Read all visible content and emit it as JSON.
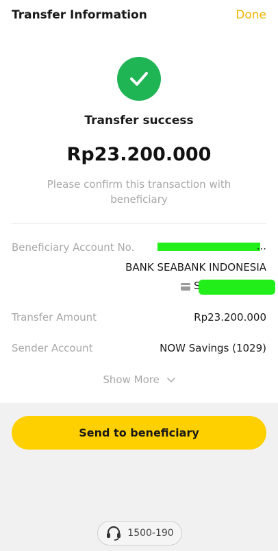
{
  "header": {
    "title": "Transfer Information",
    "done_label": "Done"
  },
  "status": {
    "icon": "check-icon",
    "text": "Transfer success",
    "amount": "Rp23.200.000",
    "note": "Please confirm this transaction with beneficiary"
  },
  "details": {
    "beneficiary_label": "Beneficiary Account No.",
    "beneficiary_name_partial": "...",
    "bank_name": "BANK SEABANK INDONESIA",
    "account_prefix": "S",
    "transfer_amount_label": "Transfer Amount",
    "transfer_amount_value": "Rp23.200.000",
    "sender_label": "Sender Account",
    "sender_value": "NOW Savings (1029)",
    "show_more_label": "Show More"
  },
  "actions": {
    "send_label": "Send to beneficiary"
  },
  "support": {
    "icon": "headset-icon",
    "number": "1500-190"
  },
  "colors": {
    "accent": "#ffd000",
    "done": "#f0b400",
    "success": "#1fb554",
    "redaction": "#22ee1a"
  }
}
